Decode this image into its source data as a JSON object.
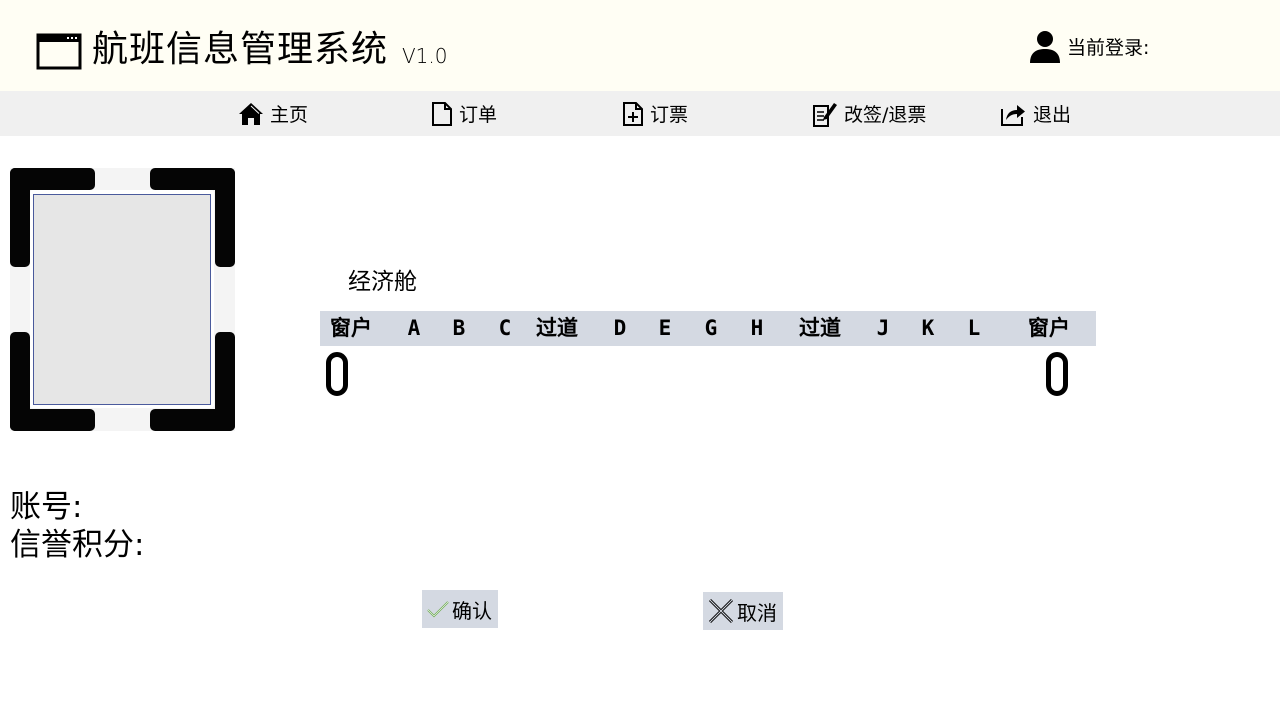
{
  "header": {
    "title": "航班信息管理系统",
    "version": "V1.0",
    "login_label": "当前登录:",
    "app_icon": "window-icon",
    "user_icon": "user-icon",
    "background": "#fffef4"
  },
  "nav": {
    "items": [
      {
        "label": "主页",
        "icon": "home-icon"
      },
      {
        "label": "订单",
        "icon": "document-icon"
      },
      {
        "label": "订票",
        "icon": "document-add-icon"
      },
      {
        "label": "改签/退票",
        "icon": "edit-icon"
      },
      {
        "label": "退出",
        "icon": "share-exit-icon"
      }
    ],
    "background": "#f0f0f0"
  },
  "cabin": {
    "label": "经济舱",
    "columns": [
      "窗户",
      "A",
      "B",
      "C",
      "过道",
      "D",
      "E",
      "G",
      "H",
      "过道",
      "J",
      "K",
      "L",
      "窗户"
    ],
    "header_color": "#d4d9e2"
  },
  "account": {
    "account_label": "账号:",
    "credit_label": "信誉积分:"
  },
  "buttons": {
    "confirm": "确认",
    "cancel": "取消",
    "confirm_icon": "check-icon",
    "cancel_icon": "close-icon"
  }
}
